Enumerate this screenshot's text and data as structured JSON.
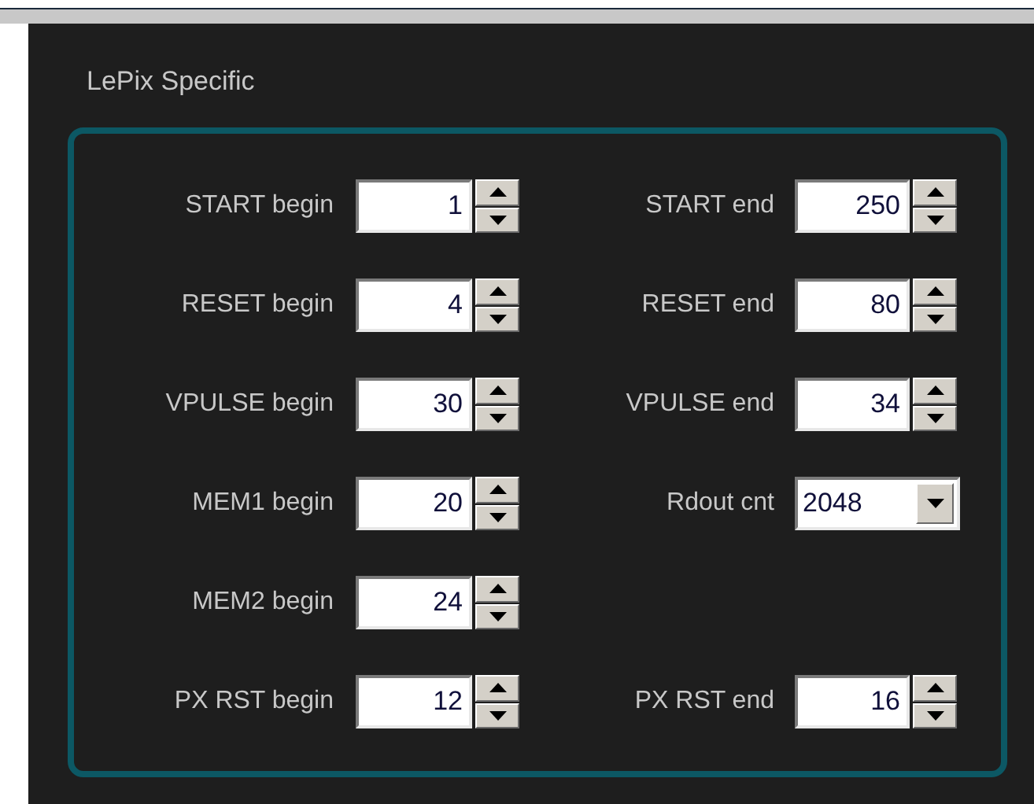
{
  "panel": {
    "title": "LePix Specific"
  },
  "rows": [
    {
      "left": {
        "kind": "spinbox",
        "label": "START begin",
        "value": "1"
      },
      "right": {
        "kind": "spinbox",
        "label": "START end",
        "value": "250"
      }
    },
    {
      "left": {
        "kind": "spinbox",
        "label": "RESET begin",
        "value": "4"
      },
      "right": {
        "kind": "spinbox",
        "label": "RESET end",
        "value": "80"
      }
    },
    {
      "left": {
        "kind": "spinbox",
        "label": "VPULSE begin",
        "value": "30"
      },
      "right": {
        "kind": "spinbox",
        "label": "VPULSE end",
        "value": "34"
      }
    },
    {
      "left": {
        "kind": "spinbox",
        "label": "MEM1 begin",
        "value": "20"
      },
      "right": {
        "kind": "dropdown",
        "label": "Rdout cnt",
        "value": "2048"
      }
    },
    {
      "left": {
        "kind": "spinbox",
        "label": "MEM2 begin",
        "value": "24"
      }
    },
    {
      "left": {
        "kind": "spinbox",
        "label": "PX RST begin",
        "value": "12"
      },
      "right": {
        "kind": "spinbox",
        "label": "PX RST end",
        "value": "16"
      }
    }
  ]
}
